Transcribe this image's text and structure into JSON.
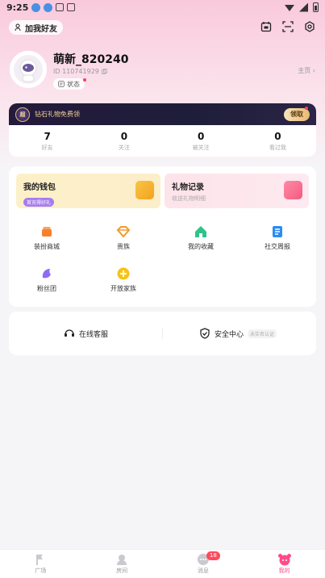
{
  "status_bar": {
    "time": "9:25"
  },
  "header": {
    "add_friend_label": "加我好友"
  },
  "profile": {
    "nickname": "萌新_820240",
    "id_text": "ID 110741929",
    "status_label": "状态",
    "homepage_label": "主页"
  },
  "vip": {
    "badge": "超",
    "text": "钻石礼物免费领",
    "button_label": "领取"
  },
  "stats": [
    {
      "value": "7",
      "label": "好友"
    },
    {
      "value": "0",
      "label": "关注"
    },
    {
      "value": "0",
      "label": "被关注"
    },
    {
      "value": "0",
      "label": "看过我"
    }
  ],
  "wallet": {
    "title": "我的钱包",
    "tag": "首充得好礼"
  },
  "gift": {
    "title": "礼物记录",
    "subtitle": "收送礼物明细"
  },
  "grid": [
    {
      "label": "装扮商城",
      "icon": "shop-icon",
      "color": "#f5822b"
    },
    {
      "label": "贵族",
      "icon": "diamond-icon",
      "color": "#f29a2e"
    },
    {
      "label": "我的收藏",
      "icon": "house-icon",
      "color": "#2ec38a"
    },
    {
      "label": "社交周报",
      "icon": "report-icon",
      "color": "#2d8cf0"
    },
    {
      "label": "粉丝团",
      "icon": "fan-icon",
      "color": "#8e6cf5"
    },
    {
      "label": "开放家族",
      "icon": "plus-icon",
      "color": "#f7c313"
    }
  ],
  "services": {
    "support_label": "在线客服",
    "security_label": "安全中心",
    "security_note": "未实名认证"
  },
  "bottom_nav": [
    {
      "label": "广场",
      "icon": "plaza-icon"
    },
    {
      "label": "房间",
      "icon": "room-icon"
    },
    {
      "label": "消息",
      "icon": "message-icon",
      "badge": "18"
    },
    {
      "label": "我的",
      "icon": "me-icon"
    }
  ],
  "colors": {
    "accent": "#ff4d8a",
    "vip_gold": "#f1d49a"
  }
}
